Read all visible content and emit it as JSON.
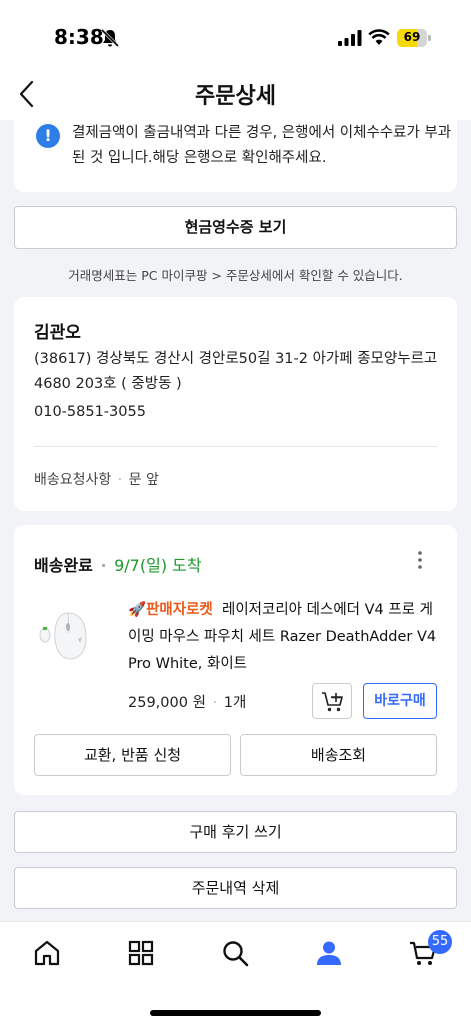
{
  "status_bar": {
    "time": "8:38",
    "battery": "69"
  },
  "header": {
    "title": "주문상세"
  },
  "notice": {
    "text": "결제금액이 출금내역과 다른 경우, 은행에서 이체수수료가 부과된 것 입니다.해당 은행으로 확인해주세요.",
    "icon": "info-icon"
  },
  "receipt": {
    "button_label": "현금영수증 보기",
    "note": "거래명세표는 PC 마이쿠팡 > 주문상세에서 확인할 수 있습니다."
  },
  "address": {
    "name": "김관오",
    "line": "(38617) 경상북도 경산시 경안로50길 31-2 아가페 종모양누르고 4680 203호 ( 중방동 )",
    "phone": "010-5851-3055",
    "request_label": "배송요청사항",
    "request_value": "문 앞"
  },
  "order": {
    "status": "배송완료",
    "arrival": "9/7(일) 도착",
    "rocket_label": "🚀판매자로켓",
    "product_name": "레이저코리아 데스에더 V4 프로 게이밍 마우스 파우치 세트 Razer DeathAdder V4 Pro White, 화이트",
    "price": "259,000 원",
    "quantity": "1개",
    "buy_now_label": "바로구매",
    "return_label": "교환, 반품 신청",
    "track_label": "배송조회"
  },
  "actions": {
    "review_label": "구매 후기 쓰기",
    "delete_label": "주문내역 삭제"
  },
  "tabbar": {
    "cart_count": "55",
    "accent_color": "#346aff",
    "items": [
      "home-icon",
      "category-icon",
      "search-icon",
      "my-coupang-icon",
      "cart-icon"
    ]
  }
}
